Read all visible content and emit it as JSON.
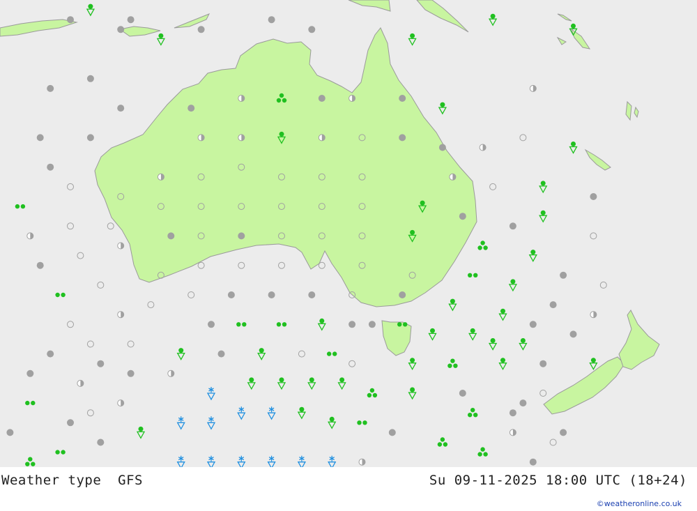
{
  "title": "Weather type",
  "model": "GFS",
  "valid_time": "Su 09-11-2025 18:00 UTC (18+24)",
  "credit": "©weatheronline.co.uk",
  "colors": {
    "sea": "#ececec",
    "land": "#c8f5a0",
    "coast": "#9a9a9a",
    "cloud": "#a0a0a0",
    "rain": "#20c020",
    "snow": "#2090e0"
  },
  "map": {
    "symbols": [
      {
        "t": "overcast",
        "lon": 111,
        "lat": -4
      },
      {
        "t": "overcast",
        "lon": 117,
        "lat": -4
      },
      {
        "t": "shower",
        "lon": 113,
        "lat": -3
      },
      {
        "t": "overcast",
        "lon": 116,
        "lat": -5
      },
      {
        "t": "shower",
        "lon": 120,
        "lat": -6
      },
      {
        "t": "overcast",
        "lon": 124,
        "lat": -5
      },
      {
        "t": "overcast",
        "lon": 131,
        "lat": -4
      },
      {
        "t": "overcast",
        "lon": 135,
        "lat": -5
      },
      {
        "t": "shower",
        "lon": 145,
        "lat": -6
      },
      {
        "t": "shower",
        "lon": 153,
        "lat": -4
      },
      {
        "t": "shower",
        "lon": 161,
        "lat": -5
      },
      {
        "t": "overcast",
        "lon": 113,
        "lat": -10
      },
      {
        "t": "overcast",
        "lon": 109,
        "lat": -11
      },
      {
        "t": "overcast",
        "lon": 116,
        "lat": -13
      },
      {
        "t": "overcast",
        "lon": 123,
        "lat": -13
      },
      {
        "t": "partly",
        "lon": 128,
        "lat": -12
      },
      {
        "t": "tstorm",
        "lon": 132,
        "lat": -12
      },
      {
        "t": "overcast",
        "lon": 136,
        "lat": -12
      },
      {
        "t": "partly",
        "lon": 139,
        "lat": -12
      },
      {
        "t": "overcast",
        "lon": 144,
        "lat": -12
      },
      {
        "t": "shower",
        "lon": 148,
        "lat": -13
      },
      {
        "t": "partly",
        "lon": 157,
        "lat": -11
      },
      {
        "t": "overcast",
        "lon": 108,
        "lat": -16
      },
      {
        "t": "overcast",
        "lon": 113,
        "lat": -16
      },
      {
        "t": "partly",
        "lon": 124,
        "lat": -16
      },
      {
        "t": "partly",
        "lon": 128,
        "lat": -16
      },
      {
        "t": "shower",
        "lon": 132,
        "lat": -16
      },
      {
        "t": "partly",
        "lon": 136,
        "lat": -16
      },
      {
        "t": "clear",
        "lon": 140,
        "lat": -16
      },
      {
        "t": "overcast",
        "lon": 144,
        "lat": -16
      },
      {
        "t": "overcast",
        "lon": 148,
        "lat": -17
      },
      {
        "t": "partly",
        "lon": 152,
        "lat": -17
      },
      {
        "t": "clear",
        "lon": 156,
        "lat": -16
      },
      {
        "t": "shower",
        "lon": 161,
        "lat": -17
      },
      {
        "t": "overcast",
        "lon": 109,
        "lat": -19
      },
      {
        "t": "clear",
        "lon": 111,
        "lat": -21
      },
      {
        "t": "partly",
        "lon": 120,
        "lat": -20
      },
      {
        "t": "clear",
        "lon": 124,
        "lat": -20
      },
      {
        "t": "clear",
        "lon": 128,
        "lat": -19
      },
      {
        "t": "clear",
        "lon": 132,
        "lat": -20
      },
      {
        "t": "clear",
        "lon": 136,
        "lat": -20
      },
      {
        "t": "clear",
        "lon": 140,
        "lat": -20
      },
      {
        "t": "partly",
        "lon": 149,
        "lat": -20
      },
      {
        "t": "clear",
        "lon": 153,
        "lat": -21
      },
      {
        "t": "shower",
        "lon": 158,
        "lat": -21
      },
      {
        "t": "overcast",
        "lon": 163,
        "lat": -22
      },
      {
        "t": "rain",
        "lon": 106,
        "lat": -23
      },
      {
        "t": "clear",
        "lon": 116,
        "lat": -22
      },
      {
        "t": "clear",
        "lon": 120,
        "lat": -23
      },
      {
        "t": "clear",
        "lon": 124,
        "lat": -23
      },
      {
        "t": "clear",
        "lon": 128,
        "lat": -23
      },
      {
        "t": "clear",
        "lon": 132,
        "lat": -23
      },
      {
        "t": "clear",
        "lon": 136,
        "lat": -23
      },
      {
        "t": "clear",
        "lon": 140,
        "lat": -23
      },
      {
        "t": "shower",
        "lon": 146,
        "lat": -23
      },
      {
        "t": "overcast",
        "lon": 150,
        "lat": -24
      },
      {
        "t": "overcast",
        "lon": 155,
        "lat": -25
      },
      {
        "t": "shower",
        "lon": 158,
        "lat": -24
      },
      {
        "t": "partly",
        "lon": 107,
        "lat": -26
      },
      {
        "t": "clear",
        "lon": 111,
        "lat": -25
      },
      {
        "t": "clear",
        "lon": 115,
        "lat": -25
      },
      {
        "t": "overcast",
        "lon": 121,
        "lat": -26
      },
      {
        "t": "clear",
        "lon": 124,
        "lat": -26
      },
      {
        "t": "overcast",
        "lon": 128,
        "lat": -26
      },
      {
        "t": "clear",
        "lon": 132,
        "lat": -26
      },
      {
        "t": "clear",
        "lon": 136,
        "lat": -26
      },
      {
        "t": "clear",
        "lon": 140,
        "lat": -26
      },
      {
        "t": "shower",
        "lon": 145,
        "lat": -26
      },
      {
        "t": "tstorm",
        "lon": 152,
        "lat": -27
      },
      {
        "t": "shower",
        "lon": 157,
        "lat": -28
      },
      {
        "t": "clear",
        "lon": 163,
        "lat": -26
      },
      {
        "t": "clear",
        "lon": 112,
        "lat": -28
      },
      {
        "t": "partly",
        "lon": 116,
        "lat": -27
      },
      {
        "t": "overcast",
        "lon": 108,
        "lat": -29
      },
      {
        "t": "clear",
        "lon": 120,
        "lat": -30
      },
      {
        "t": "clear",
        "lon": 124,
        "lat": -29
      },
      {
        "t": "clear",
        "lon": 128,
        "lat": -29
      },
      {
        "t": "clear",
        "lon": 132,
        "lat": -29
      },
      {
        "t": "clear",
        "lon": 136,
        "lat": -29
      },
      {
        "t": "clear",
        "lon": 140,
        "lat": -29
      },
      {
        "t": "clear",
        "lon": 145,
        "lat": -30
      },
      {
        "t": "rain",
        "lon": 151,
        "lat": -30
      },
      {
        "t": "shower",
        "lon": 155,
        "lat": -31
      },
      {
        "t": "overcast",
        "lon": 160,
        "lat": -30
      },
      {
        "t": "clear",
        "lon": 164,
        "lat": -31
      },
      {
        "t": "rain",
        "lon": 110,
        "lat": -32
      },
      {
        "t": "clear",
        "lon": 114,
        "lat": -31
      },
      {
        "t": "clear",
        "lon": 119,
        "lat": -33
      },
      {
        "t": "clear",
        "lon": 123,
        "lat": -32
      },
      {
        "t": "overcast",
        "lon": 127,
        "lat": -32
      },
      {
        "t": "overcast",
        "lon": 131,
        "lat": -32
      },
      {
        "t": "overcast",
        "lon": 135,
        "lat": -32
      },
      {
        "t": "clear",
        "lon": 139,
        "lat": -32
      },
      {
        "t": "overcast",
        "lon": 144,
        "lat": -32
      },
      {
        "t": "shower",
        "lon": 149,
        "lat": -33
      },
      {
        "t": "shower",
        "lon": 154,
        "lat": -34
      },
      {
        "t": "overcast",
        "lon": 159,
        "lat": -33
      },
      {
        "t": "partly",
        "lon": 163,
        "lat": -34
      },
      {
        "t": "clear",
        "lon": 111,
        "lat": -35
      },
      {
        "t": "partly",
        "lon": 116,
        "lat": -34
      },
      {
        "t": "overcast",
        "lon": 125,
        "lat": -35
      },
      {
        "t": "rain",
        "lon": 128,
        "lat": -35
      },
      {
        "t": "rain",
        "lon": 132,
        "lat": -35
      },
      {
        "t": "shower",
        "lon": 136,
        "lat": -35
      },
      {
        "t": "overcast",
        "lon": 139,
        "lat": -35
      },
      {
        "t": "overcast",
        "lon": 141,
        "lat": -35
      },
      {
        "t": "rain",
        "lon": 144,
        "lat": -35
      },
      {
        "t": "shower",
        "lon": 147,
        "lat": -36
      },
      {
        "t": "shower",
        "lon": 151,
        "lat": -36
      },
      {
        "t": "overcast",
        "lon": 157,
        "lat": -35
      },
      {
        "t": "overcast",
        "lon": 161,
        "lat": -36
      },
      {
        "t": "clear",
        "lon": 113,
        "lat": -37
      },
      {
        "t": "clear",
        "lon": 117,
        "lat": -37
      },
      {
        "t": "shower",
        "lon": 153,
        "lat": -37
      },
      {
        "t": "shower",
        "lon": 156,
        "lat": -37
      },
      {
        "t": "overcast",
        "lon": 109,
        "lat": -38
      },
      {
        "t": "overcast",
        "lon": 114,
        "lat": -39
      },
      {
        "t": "shower",
        "lon": 122,
        "lat": -38
      },
      {
        "t": "overcast",
        "lon": 126,
        "lat": -38
      },
      {
        "t": "shower",
        "lon": 130,
        "lat": -38
      },
      {
        "t": "clear",
        "lon": 134,
        "lat": -38
      },
      {
        "t": "rain",
        "lon": 137,
        "lat": -38
      },
      {
        "t": "clear",
        "lon": 139,
        "lat": -39
      },
      {
        "t": "shower",
        "lon": 145,
        "lat": -39
      },
      {
        "t": "tstorm",
        "lon": 149,
        "lat": -39
      },
      {
        "t": "shower",
        "lon": 154,
        "lat": -39
      },
      {
        "t": "overcast",
        "lon": 158,
        "lat": -39
      },
      {
        "t": "shower",
        "lon": 163,
        "lat": -39
      },
      {
        "t": "overcast",
        "lon": 107,
        "lat": -40
      },
      {
        "t": "partly",
        "lon": 112,
        "lat": -41
      },
      {
        "t": "overcast",
        "lon": 117,
        "lat": -40
      },
      {
        "t": "partly",
        "lon": 121,
        "lat": -40
      },
      {
        "t": "snow",
        "lon": 125,
        "lat": -42
      },
      {
        "t": "shower",
        "lon": 129,
        "lat": -41
      },
      {
        "t": "shower",
        "lon": 132,
        "lat": -41
      },
      {
        "t": "shower",
        "lon": 135,
        "lat": -41
      },
      {
        "t": "shower",
        "lon": 138,
        "lat": -41
      },
      {
        "t": "tstorm",
        "lon": 141,
        "lat": -42
      },
      {
        "t": "shower",
        "lon": 145,
        "lat": -42
      },
      {
        "t": "overcast",
        "lon": 150,
        "lat": -42
      },
      {
        "t": "clear",
        "lon": 158,
        "lat": -42
      },
      {
        "t": "overcast",
        "lon": 156,
        "lat": -43
      },
      {
        "t": "rain",
        "lon": 107,
        "lat": -43
      },
      {
        "t": "partly",
        "lon": 116,
        "lat": -43
      },
      {
        "t": "clear",
        "lon": 113,
        "lat": -44
      },
      {
        "t": "tstorm",
        "lon": 151,
        "lat": -44
      },
      {
        "t": "overcast",
        "lon": 155,
        "lat": -44
      },
      {
        "t": "overcast",
        "lon": 111,
        "lat": -45
      },
      {
        "t": "overcast",
        "lon": 105,
        "lat": -46
      },
      {
        "t": "shower",
        "lon": 118,
        "lat": -46
      },
      {
        "t": "snow",
        "lon": 122,
        "lat": -45
      },
      {
        "t": "snow",
        "lon": 125,
        "lat": -45
      },
      {
        "t": "snow",
        "lon": 128,
        "lat": -44
      },
      {
        "t": "snow",
        "lon": 131,
        "lat": -44
      },
      {
        "t": "shower",
        "lon": 134,
        "lat": -44
      },
      {
        "t": "shower",
        "lon": 137,
        "lat": -45
      },
      {
        "t": "rain",
        "lon": 140,
        "lat": -45
      },
      {
        "t": "overcast",
        "lon": 143,
        "lat": -46
      },
      {
        "t": "partly",
        "lon": 155,
        "lat": -46
      },
      {
        "t": "tstorm",
        "lon": 148,
        "lat": -47
      },
      {
        "t": "overcast",
        "lon": 160,
        "lat": -46
      },
      {
        "t": "clear",
        "lon": 159,
        "lat": -47
      },
      {
        "t": "rain",
        "lon": 110,
        "lat": -48
      },
      {
        "t": "overcast",
        "lon": 114,
        "lat": -47
      },
      {
        "t": "tstorm",
        "lon": 107,
        "lat": -49
      },
      {
        "t": "snow",
        "lon": 122,
        "lat": -49
      },
      {
        "t": "snow",
        "lon": 125,
        "lat": -49
      },
      {
        "t": "snow",
        "lon": 128,
        "lat": -49
      },
      {
        "t": "snow",
        "lon": 131,
        "lat": -49
      },
      {
        "t": "snow",
        "lon": 134,
        "lat": -49
      },
      {
        "t": "snow",
        "lon": 137,
        "lat": -49
      },
      {
        "t": "partly",
        "lon": 140,
        "lat": -49
      },
      {
        "t": "tstorm",
        "lon": 152,
        "lat": -48
      },
      {
        "t": "overcast",
        "lon": 157,
        "lat": -49
      }
    ]
  }
}
